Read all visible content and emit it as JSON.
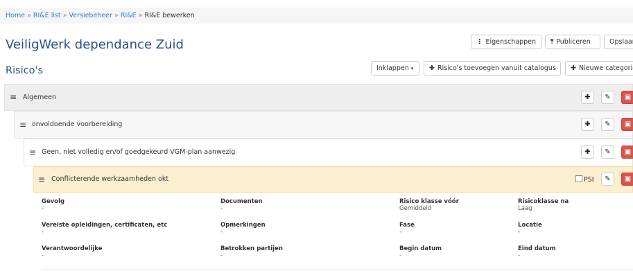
{
  "breadcrumb": {
    "items": [
      "Home",
      "RI&E list",
      "Versiebeheer",
      "RI&E"
    ],
    "separator": "»",
    "current": "RI&E bewerken"
  },
  "page_title": "VeiligWerk dependance Zuid",
  "toolbar": {
    "properties_label": "Eigenschappen",
    "publish_label": "Publiceren",
    "save_label": "Opslaan"
  },
  "section_title": "Risico's",
  "risk_toolbar": {
    "collapse_label": "Inklappen",
    "add_catalog_label": "Risico's toevoegen vanuit catalogus",
    "new_category_label": "Nieuwe categorie"
  },
  "tree": {
    "level1": "Algemeen",
    "level2": "onvoldoende voorbereiding",
    "level3": "Geen, niet volledig en/of goedgekeurd VGM-plan aanwezig",
    "level4": "Conflicterende werkzaamheden okt",
    "psi_label": "PSI"
  },
  "details": [
    {
      "label": "Gevolg",
      "value": "-"
    },
    {
      "label": "Documenten",
      "value": "-"
    },
    {
      "label": "Risico klasse vóór",
      "value": "Gemiddeld"
    },
    {
      "label": "Risicoklasse na",
      "value": "Laag"
    },
    {
      "label": "Vereiste opleidingen, certificaten, etc",
      "value": "-"
    },
    {
      "label": "Opmerkingen",
      "value": "-"
    },
    {
      "label": "Fase",
      "value": "-"
    },
    {
      "label": "Locatie",
      "value": "-"
    },
    {
      "label": "Verantwoordelijke",
      "value": "-"
    },
    {
      "label": "Betrokken partijen",
      "value": "-"
    },
    {
      "label": "Begin datum",
      "value": "-"
    },
    {
      "label": "Eind datum",
      "value": "-"
    }
  ],
  "icons": {
    "handle": "bars-icon",
    "add": "plus-circle-icon",
    "edit": "pencil-icon",
    "delete": "trash-icon",
    "upload": "upload-icon",
    "info": "info-icon",
    "caret": "caret-down-icon"
  },
  "colors": {
    "link": "#3a7bc8",
    "title": "#2a4f8a",
    "danger": "#d9534f",
    "highlight_row": "#fcefcf",
    "category_row": "#eeeeee"
  }
}
